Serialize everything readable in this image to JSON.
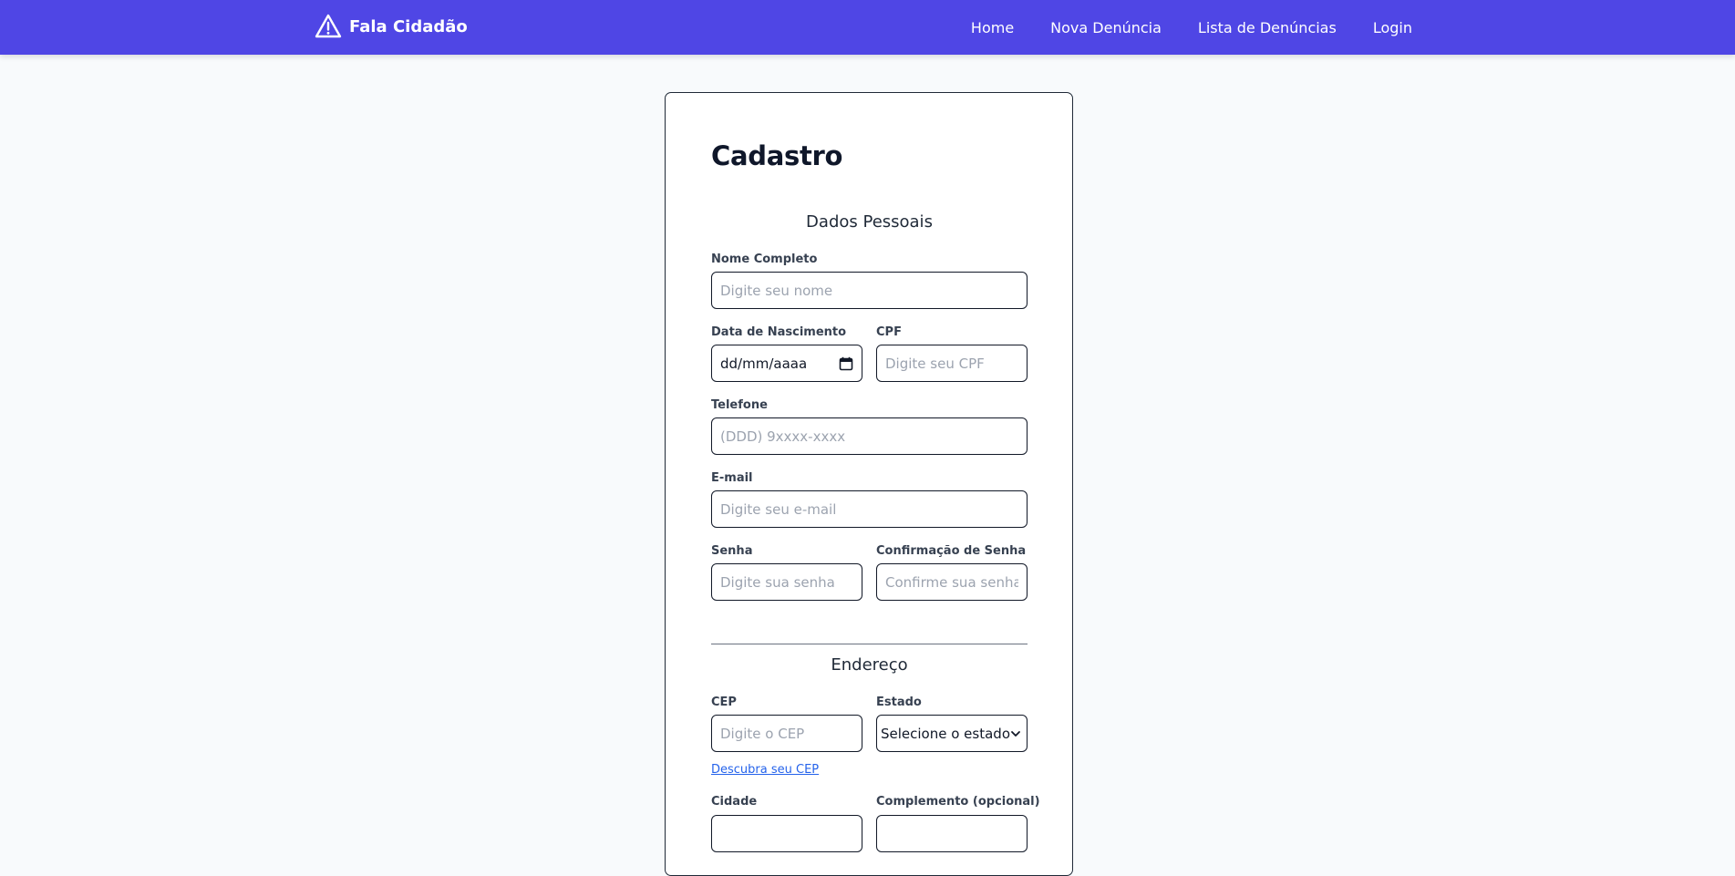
{
  "navbar": {
    "brand_name": "Fala Cidadão",
    "brand_icon": "warning-triangle-icon",
    "links": [
      {
        "label": "Home"
      },
      {
        "label": "Nova Denúncia"
      },
      {
        "label": "Lista de Denúncias"
      },
      {
        "label": "Login"
      }
    ]
  },
  "form": {
    "title": "Cadastro",
    "personal_section_title": "Dados Pessoais",
    "full_name": {
      "label": "Nome Completo",
      "placeholder": "Digite seu nome"
    },
    "birth_date": {
      "label": "Data de Nascimento",
      "value": "dd/mm/aaaa"
    },
    "cpf": {
      "label": "CPF",
      "placeholder": "Digite seu CPF"
    },
    "phone": {
      "label": "Telefone",
      "placeholder": "(DDD) 9xxxx-xxxx"
    },
    "email": {
      "label": "E-mail",
      "placeholder": "Digite seu e-mail"
    },
    "password": {
      "label": "Senha",
      "placeholder": "Digite sua senha"
    },
    "password_confirm": {
      "label": "Confirmação de Senha",
      "placeholder": "Confirme sua senha"
    },
    "address_section_title": "Endereço",
    "cep": {
      "label": "CEP",
      "placeholder": "Digite o CEP"
    },
    "state": {
      "label": "Estado",
      "selected": "Selecione o estado"
    },
    "cep_help_link": "Descubra seu CEP",
    "city": {
      "label": "Cidade"
    },
    "complement": {
      "label": "Complemento (opcional)"
    }
  },
  "colors": {
    "navbar_bg": "#4f46e5",
    "page_bg": "#f8fafc",
    "link": "#2563eb"
  }
}
